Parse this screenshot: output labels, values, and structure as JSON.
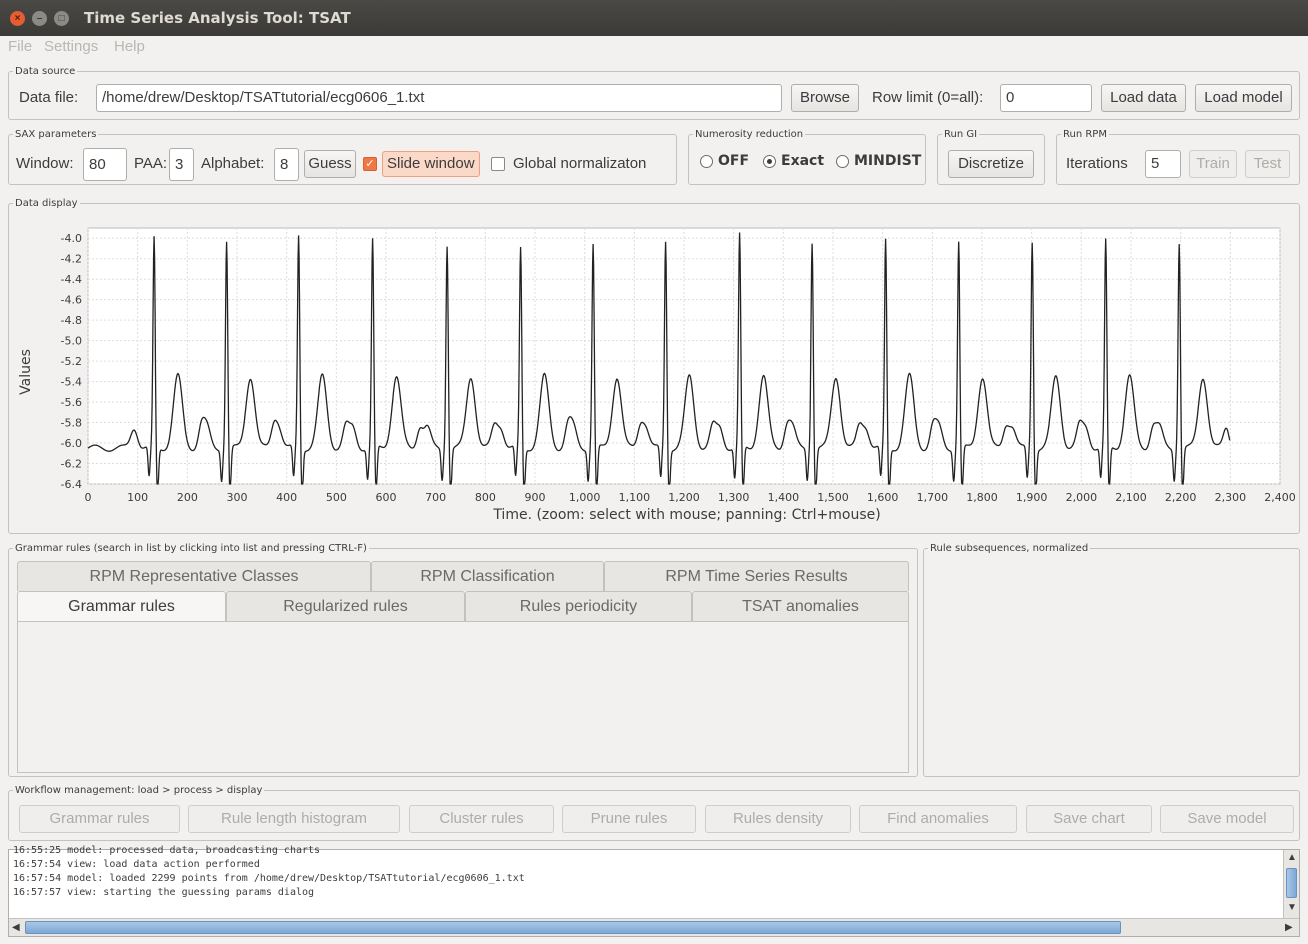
{
  "window": {
    "title": "Time Series Analysis Tool: TSAT"
  },
  "menu": [
    "File",
    "Settings",
    "Help"
  ],
  "data_source": {
    "legend": "Data source",
    "file_label": "Data file:",
    "file_value": "/home/drew/Desktop/TSATtutorial/ecg0606_1.txt",
    "browse": "Browse",
    "row_limit_label": "Row limit (0=all):",
    "row_limit_value": "0",
    "load_data": "Load data",
    "load_model": "Load model"
  },
  "sax": {
    "legend": "SAX parameters",
    "window_label": "Window:",
    "window_value": "80",
    "paa_label": "PAA:",
    "paa_value": "3",
    "alphabet_label": "Alphabet:",
    "alphabet_value": "8",
    "guess": "Guess",
    "slide_window": "Slide window",
    "slide_window_checked": true,
    "global_norm": "Global normalizaton",
    "global_norm_checked": false
  },
  "numerosity": {
    "legend": "Numerosity reduction",
    "options": [
      "OFF",
      "Exact",
      "MINDIST"
    ],
    "selected": "Exact"
  },
  "run_gi": {
    "legend": "Run GI",
    "discretize": "Discretize"
  },
  "run_rpm": {
    "legend": "Run RPM",
    "iterations_label": "Iterations",
    "iterations_value": "5",
    "train": "Train",
    "test": "Test"
  },
  "data_display": {
    "legend": "Data display"
  },
  "chart_data": {
    "type": "line",
    "xlabel": "Time. (zoom: select with mouse; panning: Ctrl+mouse)",
    "ylabel": "Values",
    "xlim": [
      0,
      2400
    ],
    "ylim": [
      -6.4,
      -3.9
    ],
    "x_ticks": [
      "0",
      "100",
      "200",
      "300",
      "400",
      "500",
      "600",
      "700",
      "800",
      "900",
      "1,000",
      "1,100",
      "1,200",
      "1,300",
      "1,400",
      "1,500",
      "1,600",
      "1,700",
      "1,800",
      "1,900",
      "2,000",
      "2,100",
      "2,200",
      "2,300",
      "2,400"
    ],
    "y_ticks": [
      "-4.0",
      "-4.2",
      "-4.4",
      "-4.6",
      "-4.8",
      "-5.0",
      "-5.2",
      "-5.4",
      "-5.6",
      "-5.8",
      "-6.0",
      "-6.2",
      "-6.4"
    ],
    "grid": true,
    "series": [
      {
        "peaks_x": [
          133,
          279,
          424,
          573,
          723,
          871,
          1017,
          1163,
          1312,
          1458,
          1606,
          1753,
          1901,
          2049,
          2197
        ],
        "peaks_y": [
          -4.0,
          -4.02,
          -3.97,
          -4.02,
          -4.05,
          -4.1,
          -4.05,
          -4.02,
          -3.97,
          -4.02,
          -4.02,
          -4.03,
          -4.02,
          -4.03,
          -4.03
        ],
        "baseline": -5.85,
        "t_wave": -5.5,
        "trough": -6.25,
        "x_end": 2299
      }
    ]
  },
  "grammar": {
    "legend": "Grammar rules (search in list by clicking into list and pressing CTRL-F)",
    "tabs_row1": [
      "RPM Representative Classes",
      "RPM Classification",
      "RPM Time Series Results"
    ],
    "tabs_row2": [
      "Grammar rules",
      "Regularized rules",
      "Rules periodicity",
      "TSAT anomalies"
    ],
    "active_tab": "Grammar rules"
  },
  "rule_subseq": {
    "legend": "Rule subsequences, normalized"
  },
  "workflow": {
    "legend": "Workflow management: load > process > display",
    "buttons": [
      "Grammar rules",
      "Rule length histogram",
      "Cluster rules",
      "Prune rules",
      "Rules density",
      "Find anomalies",
      "Save chart",
      "Save model"
    ]
  },
  "log": {
    "lines": [
      "16:55:25 model: processed data, broadcasting charts",
      "16:57:54 view: load data action performed",
      "16:57:54 model: loaded 2299 points from /home/drew/Desktop/TSATtutorial/ecg0606_1.txt",
      "16:57:57 view: starting the guessing params dialog"
    ]
  }
}
